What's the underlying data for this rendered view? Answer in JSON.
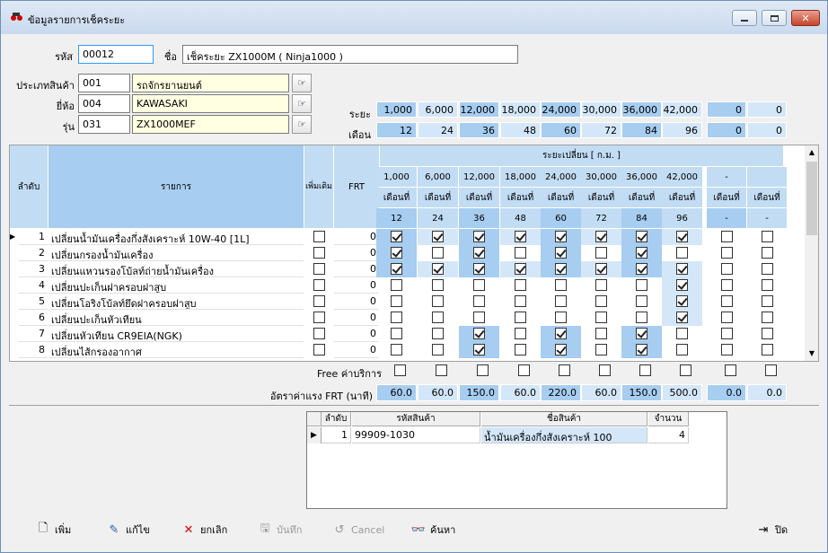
{
  "window": {
    "title": "ข้อมูลรายการเช็คระยะ"
  },
  "header": {
    "code_label": "รหัส",
    "code_value": "00012",
    "name_label": "ชื่อ",
    "name_value": "เช็คระยะ ZX1000M ( Ninja1000 )",
    "ptype_label": "ประเภทสินค้า",
    "ptype_code": "001",
    "ptype_name": "รถจักรยานยนต์",
    "brand_label": "ยี่ห้อ",
    "brand_code": "004",
    "brand_name": "KAWASAKI",
    "model_label": "รุ่น",
    "model_code": "031",
    "model_name": "ZX1000MEF"
  },
  "interval": {
    "distance_label": "ระยะ",
    "month_label": "เดือน",
    "distance": [
      "1,000",
      "6,000",
      "12,000",
      "18,000",
      "24,000",
      "30,000",
      "36,000",
      "42,000",
      "0",
      "0"
    ],
    "months": [
      "12",
      "24",
      "36",
      "48",
      "60",
      "72",
      "84",
      "96",
      "0",
      "0"
    ]
  },
  "grid": {
    "col_no": "ลำดับ",
    "col_item": "รายการ",
    "col_extra": "เพิ่มเติม",
    "col_frt": "FRT",
    "group_header": "ระยะเปลี่ยน [ ก.ม. ]",
    "km": [
      "1,000",
      "6,000",
      "12,000",
      "18,000",
      "24,000",
      "30,000",
      "36,000",
      "42,000",
      "-",
      ""
    ],
    "month_word": "เดือนที่",
    "months": [
      "12",
      "24",
      "36",
      "48",
      "60",
      "72",
      "84",
      "96",
      "-",
      "-"
    ],
    "rows": [
      {
        "no": "1",
        "item": "เปลี่ยนน้ำมันเครื่องกึ่งสังเคราะห์ 10W-40 [1L]",
        "extra": false,
        "frt": "0",
        "checks": [
          1,
          1,
          1,
          1,
          1,
          1,
          1,
          1,
          0,
          0
        ]
      },
      {
        "no": "2",
        "item": "เปลี่ยนกรองน้ำมันเครื่อง",
        "extra": false,
        "frt": "0",
        "checks": [
          1,
          0,
          1,
          0,
          1,
          0,
          1,
          0,
          0,
          0
        ]
      },
      {
        "no": "3",
        "item": "เปลี่ยนแหวนรองโบ้ลท์ถ่ายน้ำมันเครื่อง",
        "extra": false,
        "frt": "0",
        "checks": [
          1,
          1,
          1,
          1,
          1,
          1,
          1,
          1,
          0,
          0
        ]
      },
      {
        "no": "4",
        "item": "เปลี่ยนปะเก็นฝาครอบฝาสูบ",
        "extra": false,
        "frt": "0",
        "checks": [
          0,
          0,
          0,
          0,
          0,
          0,
          0,
          1,
          0,
          0
        ]
      },
      {
        "no": "5",
        "item": "เปลี่ยนโอริงโบ้ลท์ยึดฝาครอบฝาสูบ",
        "extra": false,
        "frt": "0",
        "checks": [
          0,
          0,
          0,
          0,
          0,
          0,
          0,
          1,
          0,
          0
        ]
      },
      {
        "no": "6",
        "item": "เปลี่ยนปะเก็นหัวเทียน",
        "extra": false,
        "frt": "0",
        "checks": [
          0,
          0,
          0,
          0,
          0,
          0,
          0,
          1,
          0,
          0
        ]
      },
      {
        "no": "7",
        "item": "เปลี่ยนหัวเทียน CR9EIA(NGK)",
        "extra": false,
        "frt": "0",
        "checks": [
          0,
          0,
          1,
          0,
          1,
          0,
          1,
          0,
          0,
          0
        ]
      },
      {
        "no": "8",
        "item": "เปลี่ยนไส้กรองอากาศ",
        "extra": false,
        "frt": "0",
        "checks": [
          0,
          0,
          1,
          0,
          1,
          0,
          1,
          0,
          0,
          0
        ]
      }
    ]
  },
  "footer": {
    "free_label": "Free ค่าบริการ",
    "rate_label": "อัตราค่าแรง FRT (นาที)",
    "rates": [
      "60.0",
      "60.0",
      "150.0",
      "60.0",
      "220.0",
      "60.0",
      "150.0",
      "500.0",
      "0.0",
      "0.0"
    ]
  },
  "parts": {
    "col_no": "ลำดับ",
    "col_code": "รหัสสินค้า",
    "col_name": "ชื่อสินค้า",
    "col_qty": "จำนวน",
    "rows": [
      {
        "no": "1",
        "code": "99909-1030",
        "name": "น้ำมันเครื่องกึ่งสังเคราะห์ 100",
        "qty": "4"
      }
    ]
  },
  "toolbar": {
    "add": "เพิ่ม",
    "edit": "แก้ไข",
    "cancel_del": "ยกเลิก",
    "save": "บันทึก",
    "cancel": "Cancel",
    "search": "ค้นหา",
    "close": "ปิด"
  }
}
